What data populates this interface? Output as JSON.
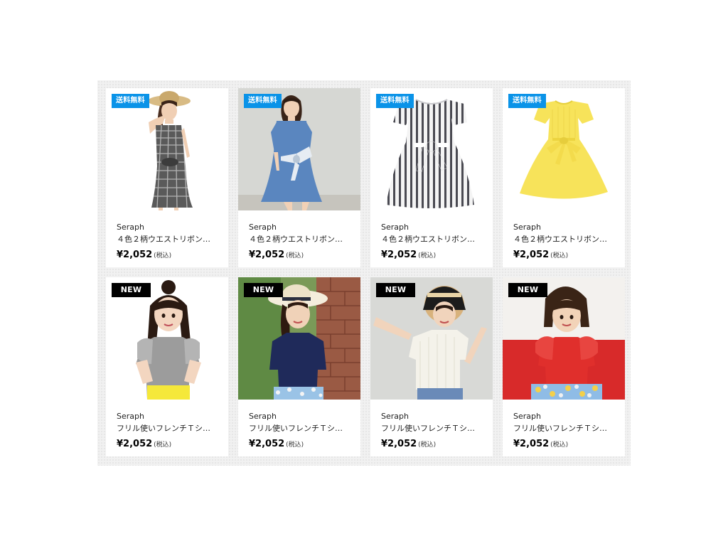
{
  "products": [
    {
      "badge": "送料無料",
      "badge_type": "free",
      "brand": "Seraph",
      "name": "４色２柄ウエストリボン…",
      "price": "¥2,052",
      "tax": "(税込)",
      "image": "gingham-dress-girl-hat"
    },
    {
      "badge": "送料無料",
      "badge_type": "free",
      "brand": "Seraph",
      "name": "４色２柄ウエストリボン…",
      "price": "¥2,052",
      "tax": "(税込)",
      "image": "chambray-dress-girl"
    },
    {
      "badge": "送料無料",
      "badge_type": "free",
      "brand": "Seraph",
      "name": "４色２柄ウエストリボン…",
      "price": "¥2,052",
      "tax": "(税込)",
      "image": "striped-dress-flat"
    },
    {
      "badge": "送料無料",
      "badge_type": "free",
      "brand": "Seraph",
      "name": "４色２柄ウエストリボン…",
      "price": "¥2,052",
      "tax": "(税込)",
      "image": "yellow-dress-flat"
    },
    {
      "badge": "NEW",
      "badge_type": "new",
      "brand": "Seraph",
      "name": "フリル使いフレンチＴシ…",
      "price": "¥2,052",
      "tax": "(税込)",
      "image": "grey-tee-girl"
    },
    {
      "badge": "NEW",
      "badge_type": "new",
      "brand": "Seraph",
      "name": "フリル使いフレンチＴシ…",
      "price": "¥2,052",
      "tax": "(税込)",
      "image": "navy-tee-girl-hat"
    },
    {
      "badge": "NEW",
      "badge_type": "new",
      "brand": "Seraph",
      "name": "フリル使いフレンチＴシ…",
      "price": "¥2,052",
      "tax": "(税込)",
      "image": "white-tee-girl-hat"
    },
    {
      "badge": "NEW",
      "badge_type": "new",
      "brand": "Seraph",
      "name": "フリル使いフレンチＴシ…",
      "price": "¥2,052",
      "tax": "(税込)",
      "image": "red-tee-girl"
    }
  ],
  "colors": {
    "free_badge": "#0a93e8",
    "new_badge": "#000000",
    "page_bg": "#ffffff",
    "grid_bg": "#f1f1f1"
  }
}
